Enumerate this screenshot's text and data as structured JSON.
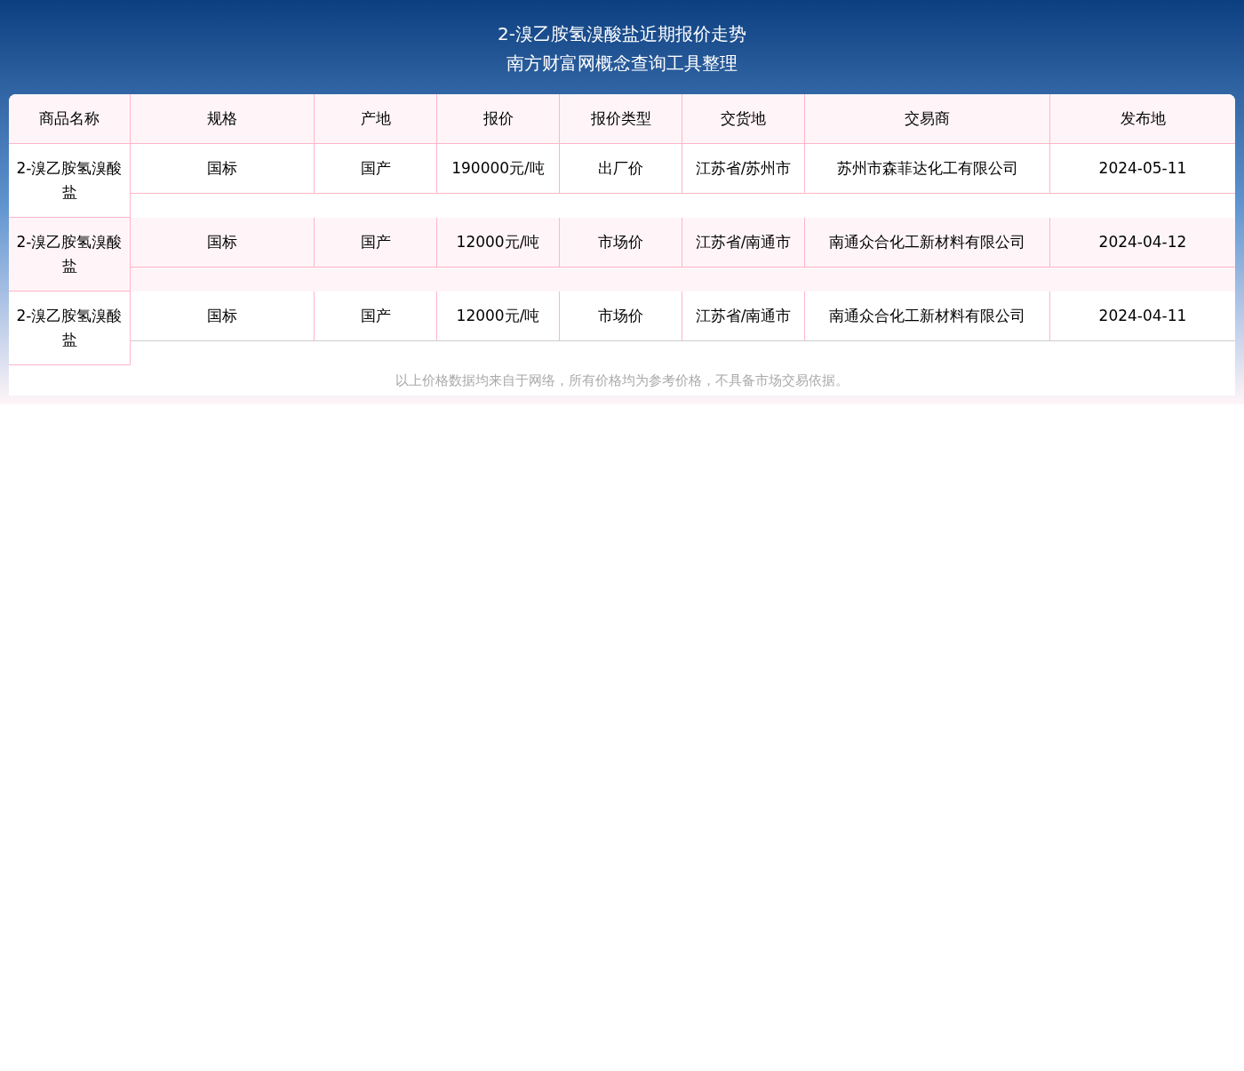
{
  "header": {
    "title": "2-溴乙胺氢溴酸盐近期报价走势",
    "subtitle": "南方财富网概念查询工具整理"
  },
  "table": {
    "columns": [
      "商品名称",
      "规格",
      "产地",
      "报价",
      "报价类型",
      "交货地",
      "交易商",
      "发布地"
    ],
    "rows": [
      {
        "cells": [
          "2-溴乙胺氢溴酸盐",
          "国标",
          "国产",
          "190000元/吨",
          "出厂价",
          "江苏省/苏州市",
          "苏州市森菲达化工有限公司",
          "2024-05-11"
        ]
      },
      {
        "cells": [
          "2-溴乙胺氢溴酸盐",
          "国标",
          "国产",
          "12000元/吨",
          "市场价",
          "江苏省/南通市",
          "南通众合化工新材料有限公司",
          "2024-04-12"
        ]
      },
      {
        "cells": [
          "2-溴乙胺氢溴酸盐",
          "国标",
          "国产",
          "12000元/吨",
          "市场价",
          "江苏省/南通市",
          "南通众合化工新材料有限公司",
          "2024-04-11"
        ]
      }
    ]
  },
  "note": "以上价格数据均来自于网络，所有价格均为参考价格，不具备市场交易依据。"
}
